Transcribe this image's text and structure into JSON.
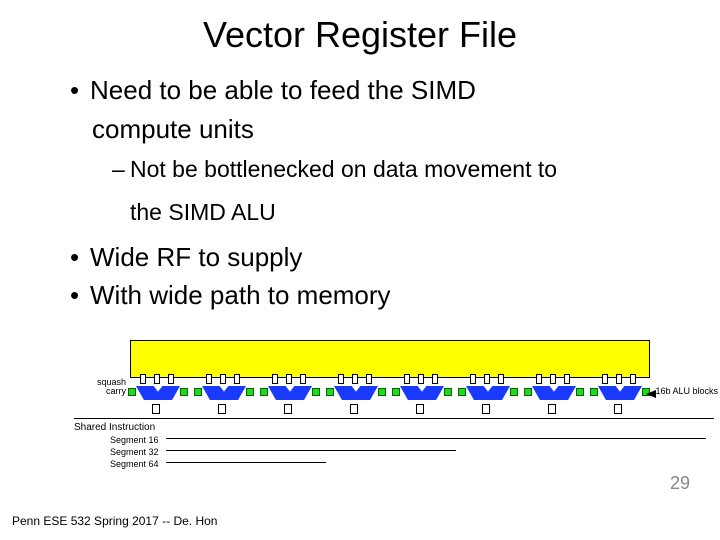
{
  "title": "Vector Register File",
  "bullets": {
    "b1a": "Need to be able to feed the SIMD",
    "b1b": "compute units",
    "s1a": "Not be bottlenecked on data movement to",
    "s1b": "the SIMD ALU",
    "b2": "Wide RF to supply",
    "b3": "With wide path to memory"
  },
  "diagram": {
    "squash": "squash\ncarry",
    "alu_label": "16b ALU blocks",
    "shared": "Shared Instruction",
    "seg16": "Segment 16",
    "seg32": "Segment 32",
    "seg64": "Segment 64"
  },
  "footer": "Penn ESE 532 Spring 2017 -- De. Hon",
  "pagenum": "29"
}
